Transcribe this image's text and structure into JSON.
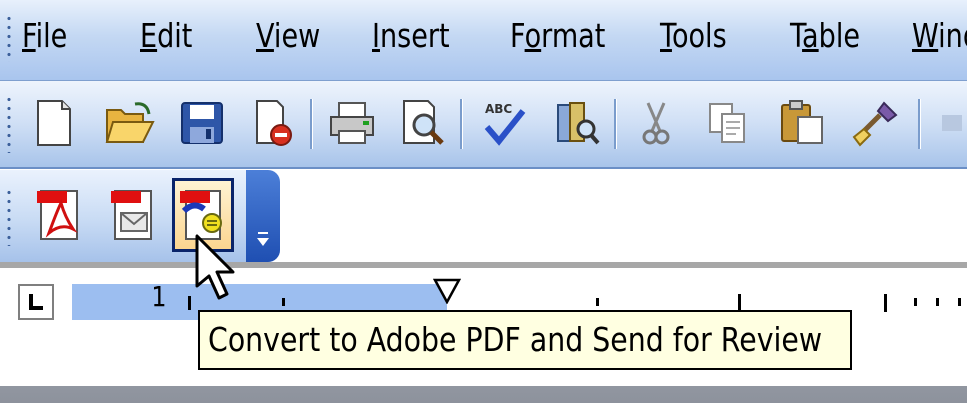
{
  "menubar": {
    "items": [
      {
        "pre": "",
        "acc": "F",
        "post": "ile"
      },
      {
        "pre": "",
        "acc": "E",
        "post": "dit"
      },
      {
        "pre": "",
        "acc": "V",
        "post": "iew"
      },
      {
        "pre": "",
        "acc": "I",
        "post": "nsert"
      },
      {
        "pre": "F",
        "acc": "o",
        "post": "rmat"
      },
      {
        "pre": "",
        "acc": "T",
        "post": "ools"
      },
      {
        "pre": "T",
        "acc": "a",
        "post": "ble"
      },
      {
        "pre": "",
        "acc": "W",
        "post": "ind"
      }
    ]
  },
  "standard_toolbar": {
    "icons": [
      "new-document-icon",
      "open-folder-icon",
      "save-icon",
      "permission-icon",
      "print-icon",
      "print-preview-icon",
      "spelling-icon",
      "research-icon",
      "cut-icon",
      "copy-icon",
      "paste-icon",
      "format-painter-icon"
    ]
  },
  "pdf_toolbar": {
    "buttons": [
      "convert-to-pdf-icon",
      "convert-and-email-icon",
      "convert-and-send-for-review-icon"
    ],
    "hovered_index": 2
  },
  "ruler": {
    "label_1": "1"
  },
  "tooltip": {
    "text": "Convert to Adobe PDF and Send for Review"
  },
  "colors": {
    "tooltip_bg": "#ffffe1",
    "toolbar_blue": "#c4d8f3",
    "overflow_blue": "#1f4fb2"
  }
}
